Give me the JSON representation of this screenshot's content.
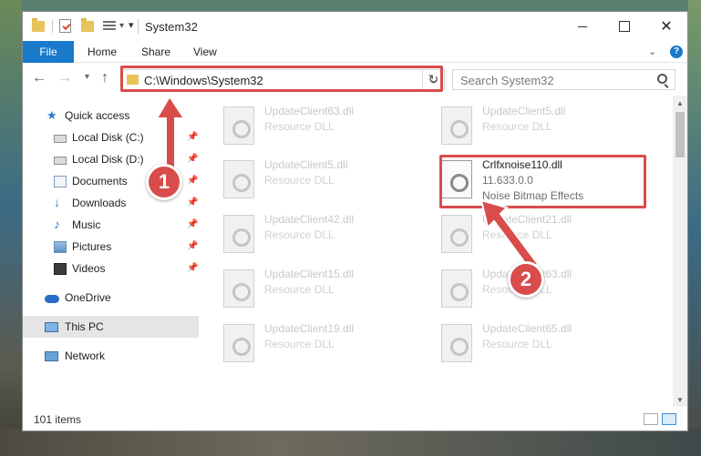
{
  "window": {
    "title": "System32"
  },
  "ribbon": {
    "tabs": [
      "File",
      "Home",
      "Share",
      "View"
    ],
    "help": "?"
  },
  "nav": {
    "address": "C:\\Windows\\System32",
    "search_placeholder": "Search System32"
  },
  "sidebar": {
    "items": [
      {
        "label": "Quick access",
        "icon": "star-icon"
      },
      {
        "label": "Local Disk (C:)",
        "icon": "drive-icon"
      },
      {
        "label": "Local Disk (D:)",
        "icon": "drive-icon"
      },
      {
        "label": "Documents",
        "icon": "documents-icon"
      },
      {
        "label": "Downloads",
        "icon": "download-arrow-icon"
      },
      {
        "label": "Music",
        "icon": "music-note-icon"
      },
      {
        "label": "Pictures",
        "icon": "pictures-icon"
      },
      {
        "label": "Videos",
        "icon": "film-icon"
      },
      {
        "label": "OneDrive",
        "icon": "cloud-icon"
      },
      {
        "label": "This PC",
        "icon": "monitor-icon"
      },
      {
        "label": "Network",
        "icon": "network-icon"
      }
    ]
  },
  "files": {
    "col1": [
      {
        "name": "UpdateClient63.dll",
        "desc": "Resource DLL"
      },
      {
        "name": "UpdateClient5.dll",
        "desc": "Resource DLL"
      },
      {
        "name": "UpdateClient42.dll",
        "desc": "Resource DLL"
      },
      {
        "name": "UpdateClient15.dll",
        "desc": "Resource DLL"
      },
      {
        "name": "UpdateClient19.dll",
        "desc": "Resource DLL"
      }
    ],
    "col2": [
      {
        "name": "UpdateClient5.dll",
        "desc": "Resource DLL"
      },
      {
        "name": "UpdateClient21.dll",
        "desc": "Resource DLL"
      },
      {
        "name": "UpdateClient63.dll",
        "desc": "Resource DLL"
      },
      {
        "name": "UpdateClient65.dll",
        "desc": "Resource DLL"
      }
    ],
    "highlighted": {
      "name": "Crlfxnoise110.dll",
      "version": "11.633.0.0",
      "desc": "Noise Bitmap Effects"
    }
  },
  "status": {
    "count": "101 items"
  },
  "annotations": {
    "step1": "1",
    "step2": "2",
    "color": "#d84c4c"
  }
}
